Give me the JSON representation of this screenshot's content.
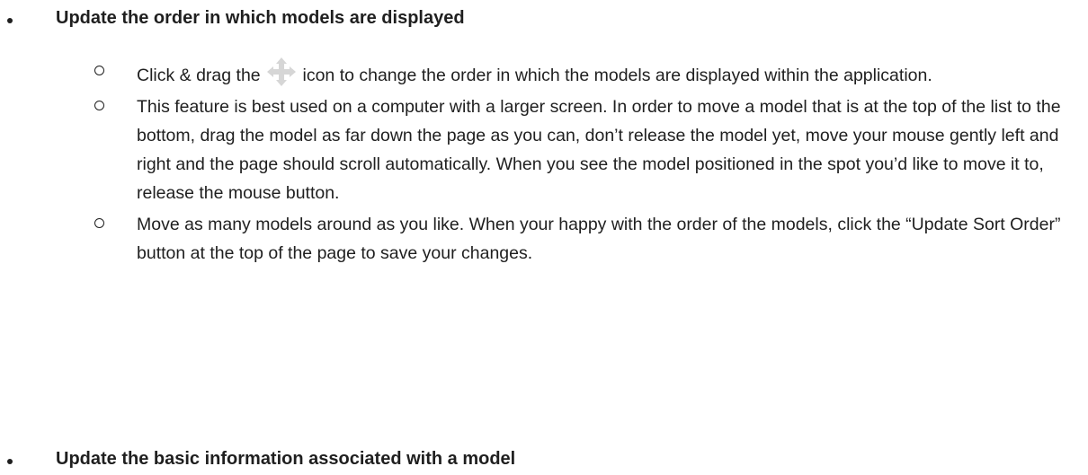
{
  "document": {
    "sections": [
      {
        "heading": "Update the order in which models are displayed",
        "items": [
          {
            "before": "Click & drag the",
            "icon": "move-arrows-icon",
            "after": "icon to change the order in which the models are displayed within the application."
          },
          {
            "text": "This feature is best used on a computer with a larger screen. In order to move a model that is at the top of the list to the bottom, drag the model as far down the page as you can, don’t release the model yet, move your mouse gently left and right and the page should scroll automatically. When you see the model positioned in the spot you’d like to move it to, release the mouse button."
          },
          {
            "text": "Move as many models around as you like. When your happy with the order of the models, click the “Update Sort Order” button at the top of the page to save your changes."
          }
        ]
      },
      {
        "heading": "Update the basic information associated with a model"
      }
    ],
    "colors": {
      "text": "#1f1f1f",
      "icon": "#d6d6d6"
    }
  }
}
